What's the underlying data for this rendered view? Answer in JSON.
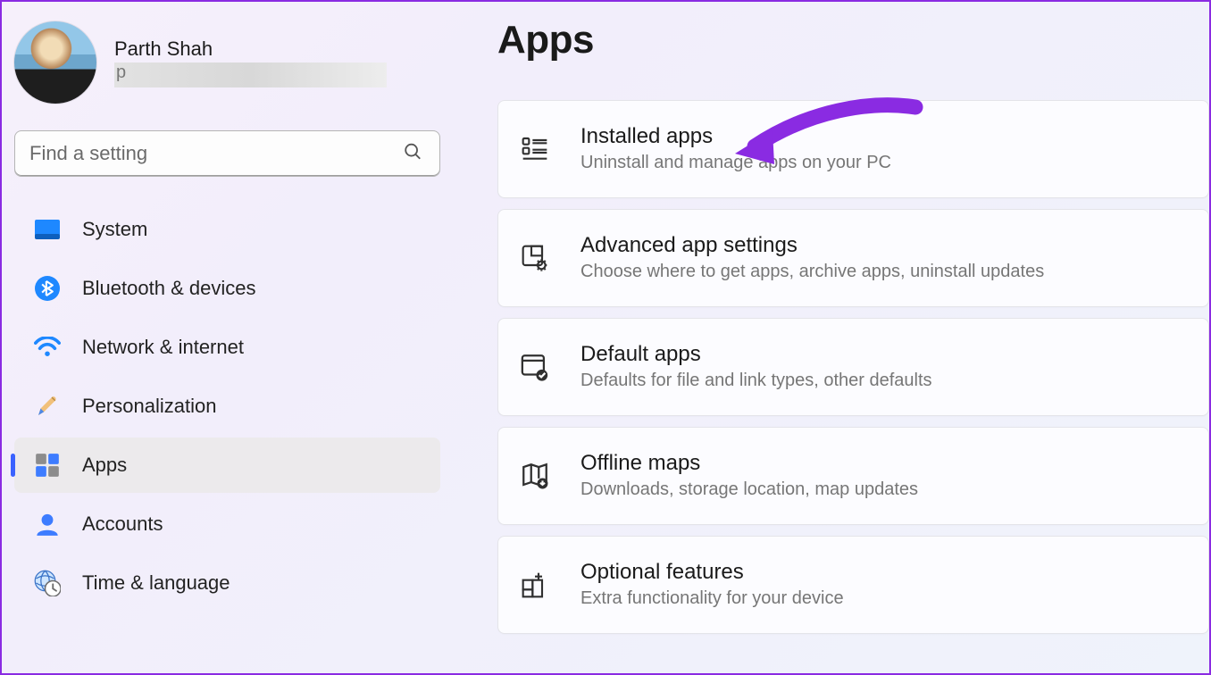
{
  "profile": {
    "name": "Parth Shah",
    "email": "p"
  },
  "search": {
    "placeholder": "Find a setting"
  },
  "sidebar": {
    "items": [
      {
        "label": "System"
      },
      {
        "label": "Bluetooth & devices"
      },
      {
        "label": "Network & internet"
      },
      {
        "label": "Personalization"
      },
      {
        "label": "Apps"
      },
      {
        "label": "Accounts"
      },
      {
        "label": "Time & language"
      }
    ]
  },
  "main": {
    "title": "Apps",
    "cards": [
      {
        "title": "Installed apps",
        "subtitle": "Uninstall and manage apps on your PC"
      },
      {
        "title": "Advanced app settings",
        "subtitle": "Choose where to get apps, archive apps, uninstall updates"
      },
      {
        "title": "Default apps",
        "subtitle": "Defaults for file and link types, other defaults"
      },
      {
        "title": "Offline maps",
        "subtitle": "Downloads, storage location, map updates"
      },
      {
        "title": "Optional features",
        "subtitle": "Extra functionality for your device"
      }
    ]
  },
  "colors": {
    "accent": "#3a62ff",
    "arrow": "#8a2be2"
  }
}
